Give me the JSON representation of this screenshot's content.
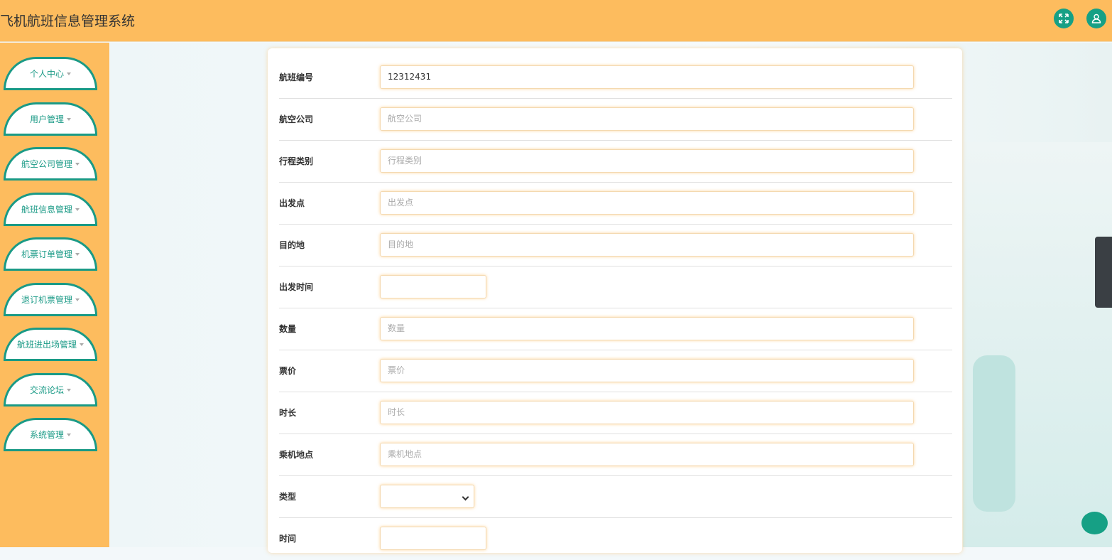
{
  "header": {
    "title": "飞机航班信息管理系统",
    "icons": [
      "fullscreen-icon",
      "user-icon"
    ]
  },
  "sidebar": {
    "items": [
      {
        "label": "个人中心"
      },
      {
        "label": "用户管理"
      },
      {
        "label": "航空公司管理"
      },
      {
        "label": "航班信息管理"
      },
      {
        "label": "机票订单管理"
      },
      {
        "label": "退订机票管理"
      },
      {
        "label": "航班进出场管理"
      },
      {
        "label": "交流论坛"
      },
      {
        "label": "系统管理"
      }
    ]
  },
  "form": {
    "fields": [
      {
        "label": "航班编号",
        "value": "12312431"
      },
      {
        "label": "航空公司",
        "placeholder": "航空公司"
      },
      {
        "label": "行程类别",
        "placeholder": "行程类别"
      },
      {
        "label": "出发点",
        "placeholder": "出发点"
      },
      {
        "label": "目的地",
        "placeholder": "目的地"
      },
      {
        "label": "出发时间",
        "placeholder": ""
      },
      {
        "label": "数量",
        "placeholder": "数量"
      },
      {
        "label": "票价",
        "placeholder": "票价"
      },
      {
        "label": "时长",
        "placeholder": "时长"
      },
      {
        "label": "乘机地点",
        "placeholder": "乘机地点"
      },
      {
        "label": "类型",
        "value": ""
      },
      {
        "label": "时间",
        "placeholder": ""
      }
    ]
  }
}
